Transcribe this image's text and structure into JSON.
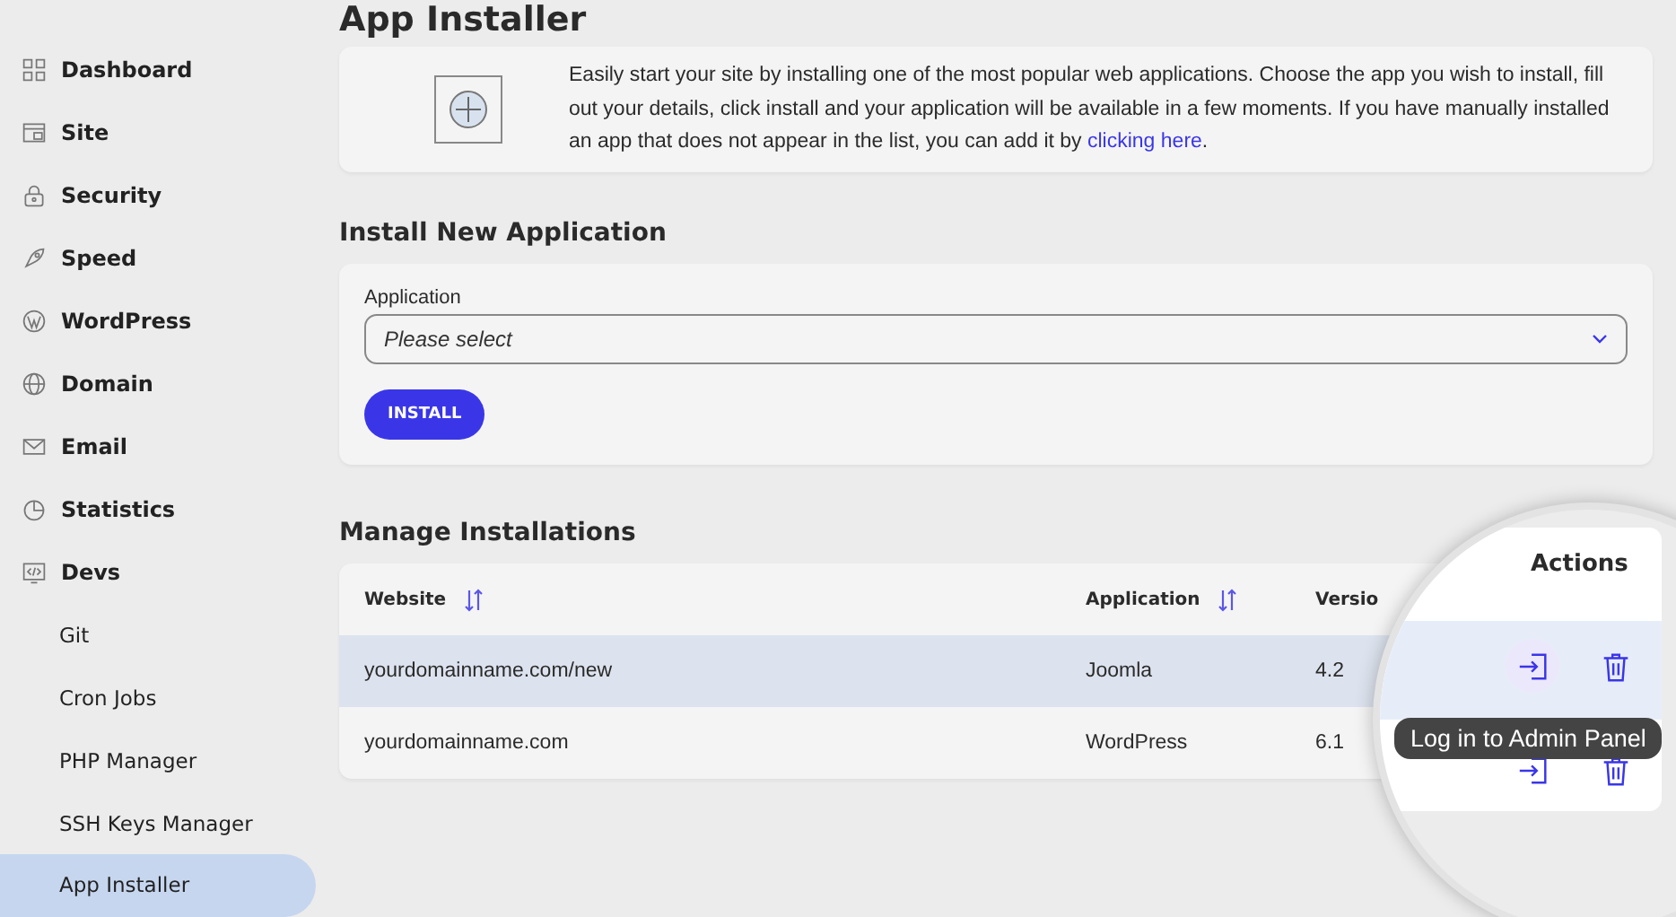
{
  "sidebar": {
    "items": [
      {
        "label": "Dashboard",
        "selected": false
      },
      {
        "label": "Site",
        "selected": false
      },
      {
        "label": "Security",
        "selected": false
      },
      {
        "label": "Speed",
        "selected": false
      },
      {
        "label": "WordPress",
        "selected": false
      },
      {
        "label": "Domain",
        "selected": false
      },
      {
        "label": "Email",
        "selected": false
      },
      {
        "label": "Statistics",
        "selected": false
      },
      {
        "label": "Devs",
        "selected": false,
        "children": [
          {
            "label": "Git",
            "selected": false
          },
          {
            "label": "Cron Jobs",
            "selected": false
          },
          {
            "label": "PHP Manager",
            "selected": false
          },
          {
            "label": "SSH Keys Manager",
            "selected": false
          },
          {
            "label": "App Installer",
            "selected": true
          }
        ]
      }
    ]
  },
  "page": {
    "title": "App Installer"
  },
  "intro": {
    "text": "Easily start your site by installing one of the most popular web applications. Choose the app you wish to install, fill out your details, click install and your application will be available in a few moments. If you have manually installed an app that does not appear in the list, you can add it by",
    "link": "clicking here",
    "end": "."
  },
  "install": {
    "heading": "Install New Application",
    "field_label": "Application",
    "placeholder": "Please select",
    "button": "INSTALL"
  },
  "installations": {
    "heading": "Manage Installations",
    "columns": [
      {
        "label": "Website",
        "sortable": true
      },
      {
        "label": "Application",
        "sortable": true
      },
      {
        "label": "Versio",
        "sortable": false
      }
    ],
    "rows": [
      {
        "website": "yourdomainname.com/new",
        "application": "Joomla",
        "version": "4.2",
        "selected": true
      },
      {
        "website": "yourdomainname.com",
        "application": "WordPress",
        "version": "6.1",
        "selected": false
      }
    ]
  },
  "magnifier": {
    "header": "Actions",
    "tooltip": "Log in to Admin Panel"
  }
}
